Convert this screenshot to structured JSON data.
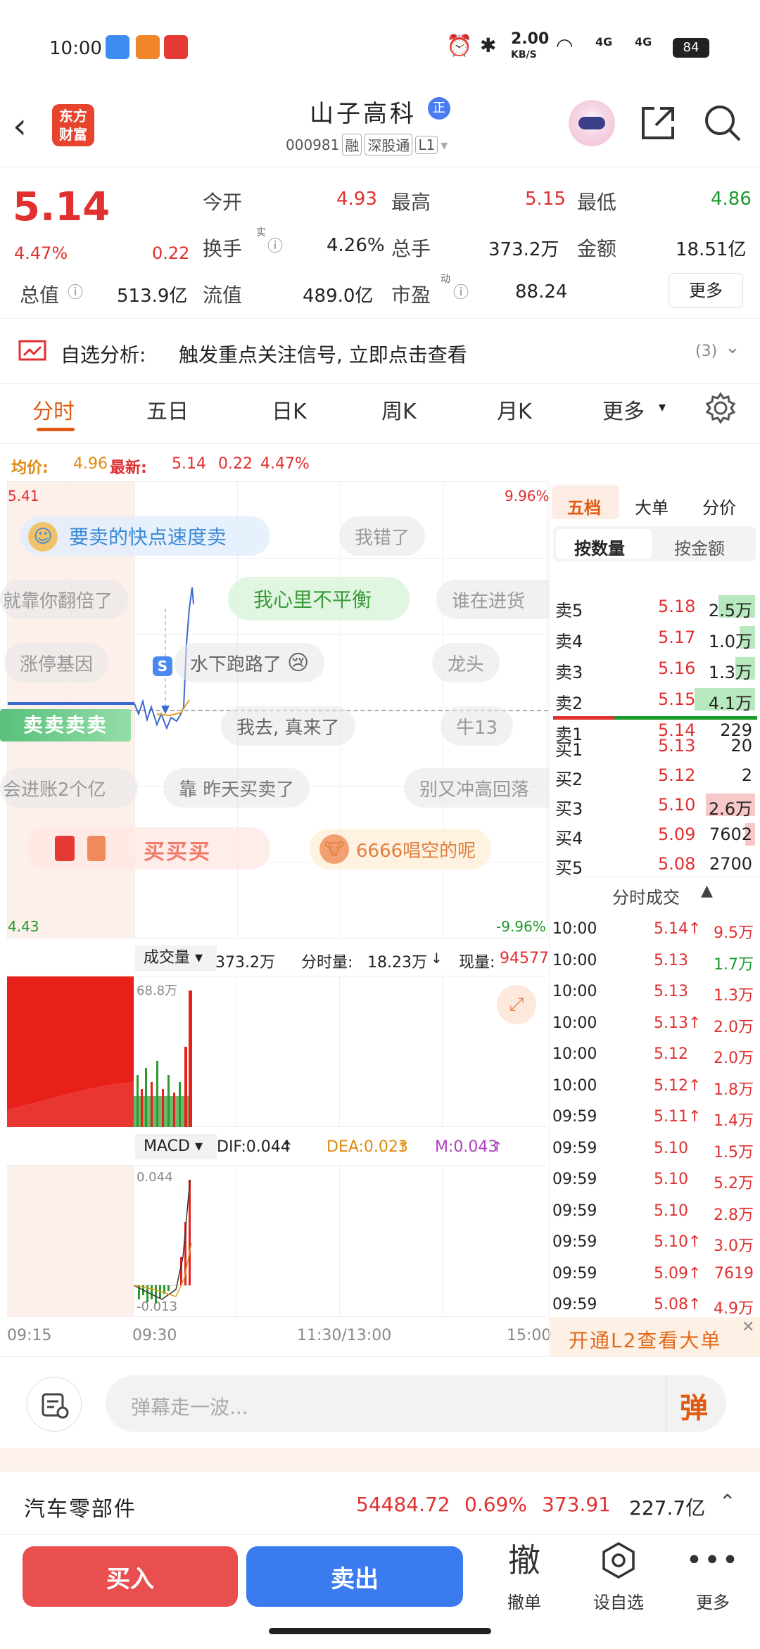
{
  "status_bar": {
    "time": "10:00",
    "net_speed": "2.00",
    "net_unit": "KB/S",
    "sig1": "4G",
    "sig2": "4G",
    "battery": "84"
  },
  "header": {
    "logo_line1": "东方",
    "logo_line2": "财富",
    "stock_name": "山子高科",
    "badge": "正",
    "code": "000981",
    "tag1": "融",
    "tag2": "深股通",
    "tag3": "L1"
  },
  "quote": {
    "price": "5.14",
    "change_pct": "4.47%",
    "change": "0.22",
    "open_label": "今开",
    "open": "4.93",
    "high_label": "最高",
    "high": "5.15",
    "low_label": "最低",
    "low": "4.86",
    "turnover_label": "换手",
    "turnover_sup": "实",
    "turnover": "4.26%",
    "volume_label": "总手",
    "volume": "373.2万",
    "amount_label": "金额",
    "amount": "18.51亿",
    "mktcap_label": "总值",
    "mktcap": "513.9亿",
    "float_label": "流值",
    "float": "489.0亿",
    "pe_label": "市盈",
    "pe_sup": "动",
    "pe": "88.24",
    "more": "更多"
  },
  "analysis": {
    "label": "自选分析:",
    "text": "触发重点关注信号, 立即点击查看",
    "count": "(3)"
  },
  "tabs": [
    "分时",
    "五日",
    "日K",
    "周K",
    "月K",
    "更多"
  ],
  "chart_info": {
    "avg_label": "均价:",
    "avg": "4.96",
    "latest_label": "最新:",
    "latest": "5.14",
    "chg": "0.22",
    "pct": "4.47%"
  },
  "price_axis": {
    "top": "5.41",
    "top_pct": "9.96%",
    "bottom": "4.43",
    "bottom_pct": "-9.96%"
  },
  "danmaku": {
    "b1": "要卖的快点速度卖",
    "b2": "我错了",
    "b3": "就靠你翻倍了",
    "b4": "我心里不平衡",
    "b5": "谁在进货",
    "b6": "涨停基因",
    "b7": "水下跑路了",
    "b8": "龙头",
    "b9": "我去, 真来了",
    "b10": "牛13",
    "b11": "会进账2个亿",
    "b12": "靠 昨天买卖了",
    "b13": "别又冲高回落",
    "b14": "6666唱空的呢",
    "sell_tag": "卖卖卖卖",
    "buy_tag": "买买买",
    "s_mark": "S"
  },
  "volume_bar": {
    "label": "成交量",
    "total": "373.2万",
    "tick_label": "分时量:",
    "tick": "18.23万",
    "now_label": "现量:",
    "now": "94577",
    "max": "68.8万"
  },
  "macd": {
    "label": "MACD",
    "dif": "DIF:0.044",
    "dea": "DEA:0.023",
    "m": "M:0.043",
    "top": "0.044",
    "bottom": "-0.013"
  },
  "time_axis": [
    "09:15",
    "09:30",
    "11:30/13:00",
    "15:00"
  ],
  "orderbook": {
    "tabs": [
      "五档",
      "大单",
      "分价"
    ],
    "sub_tabs": [
      "按数量",
      "按金额"
    ],
    "asks": [
      {
        "label": "卖5",
        "price": "5.18",
        "vol": "2.5万"
      },
      {
        "label": "卖4",
        "price": "5.17",
        "vol": "1.0万"
      },
      {
        "label": "卖3",
        "price": "5.16",
        "vol": "1.3万"
      },
      {
        "label": "卖2",
        "price": "5.15",
        "vol": "4.1万"
      },
      {
        "label": "卖1",
        "price": "5.14",
        "vol": "229"
      }
    ],
    "bids": [
      {
        "label": "买1",
        "price": "5.13",
        "vol": "20"
      },
      {
        "label": "买2",
        "price": "5.12",
        "vol": "2"
      },
      {
        "label": "买3",
        "price": "5.10",
        "vol": "2.6万"
      },
      {
        "label": "买4",
        "price": "5.09",
        "vol": "7602"
      },
      {
        "label": "买5",
        "price": "5.08",
        "vol": "2700"
      }
    ],
    "trades_title": "分时成交",
    "trades": [
      {
        "t": "10:00",
        "p": "5.14↑",
        "v": "9.5万",
        "c": "red"
      },
      {
        "t": "10:00",
        "p": "5.13",
        "v": "1.7万",
        "c": "green"
      },
      {
        "t": "10:00",
        "p": "5.13",
        "v": "1.3万",
        "c": "red"
      },
      {
        "t": "10:00",
        "p": "5.13↑",
        "v": "2.0万",
        "c": "red"
      },
      {
        "t": "10:00",
        "p": "5.12",
        "v": "2.0万",
        "c": "red"
      },
      {
        "t": "10:00",
        "p": "5.12↑",
        "v": "1.8万",
        "c": "red"
      },
      {
        "t": "09:59",
        "p": "5.11↑",
        "v": "1.4万",
        "c": "red"
      },
      {
        "t": "09:59",
        "p": "5.10",
        "v": "1.5万",
        "c": "red"
      },
      {
        "t": "09:59",
        "p": "5.10",
        "v": "5.2万",
        "c": "red"
      },
      {
        "t": "09:59",
        "p": "5.10",
        "v": "2.8万",
        "c": "red"
      },
      {
        "t": "09:59",
        "p": "5.10↑",
        "v": "3.0万",
        "c": "red"
      },
      {
        "t": "09:59",
        "p": "5.09↑",
        "v": "7619",
        "c": "red"
      },
      {
        "t": "09:59",
        "p": "5.08↑",
        "v": "4.9万",
        "c": "red"
      }
    ],
    "l2_promo": "开通L2查看大单"
  },
  "comment": {
    "placeholder": "弹幕走一波...",
    "send": "弹"
  },
  "sector": {
    "name": "汽车零部件",
    "index": "54484.72",
    "pct": "0.69%",
    "chg": "373.91",
    "amount": "227.7亿"
  },
  "bottom": {
    "buy": "买入",
    "sell": "卖出",
    "cancel_icon": "撤",
    "cancel": "撤单",
    "watch": "设自选",
    "more": "更多"
  },
  "colors": {
    "red": "#e03030",
    "green": "#1a9a2a",
    "orange": "#e08a10",
    "blue": "#3a7bf0"
  }
}
